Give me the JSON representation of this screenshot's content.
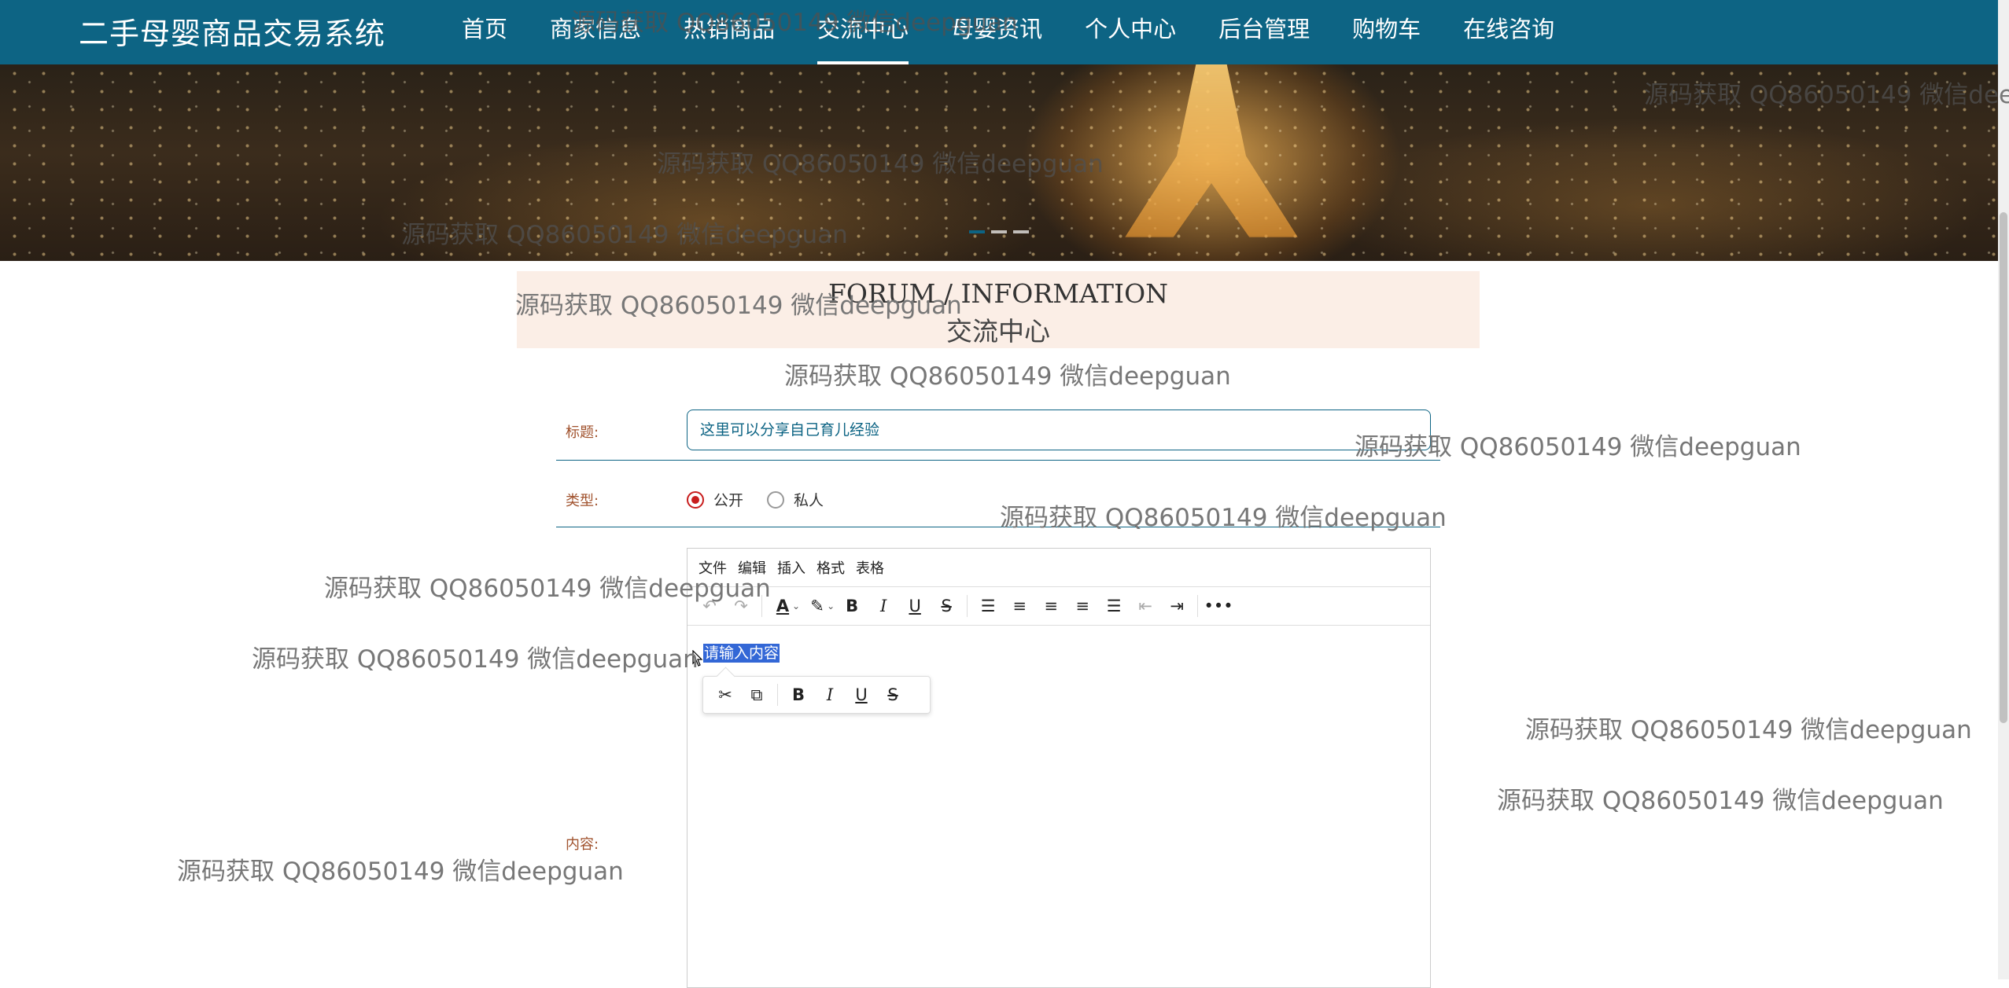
{
  "app": {
    "brand": "二手母婴商品交易系统"
  },
  "nav": {
    "items": [
      "首页",
      "商家信息",
      "热销商品",
      "交流中心",
      "母婴资讯",
      "个人中心",
      "后台管理",
      "购物车",
      "在线咨询"
    ],
    "active_index": 3
  },
  "banner": {
    "slides": 3,
    "active_slide": 1
  },
  "section": {
    "title_en": "FORUM / INFORMATION",
    "title_zh": "交流中心"
  },
  "form": {
    "title_label": "标题:",
    "title_value": "这里可以分享自己育儿经验",
    "type_label": "类型:",
    "type_options": [
      "公开",
      "私人"
    ],
    "type_selected": "公开",
    "content_label": "内容:"
  },
  "editor": {
    "menus": [
      "文件",
      "编辑",
      "插入",
      "格式",
      "表格"
    ],
    "placeholder": "请输入内容",
    "toolbar_icons": [
      "undo-icon",
      "redo-icon",
      "text-color-icon",
      "highlight-icon",
      "bold-icon",
      "italic-icon",
      "underline-icon",
      "strikethrough-icon",
      "line-height-icon",
      "align-left-icon",
      "align-center-icon",
      "align-right-icon",
      "align-justify-icon",
      "outdent-icon",
      "indent-icon",
      "more-icon"
    ],
    "quickbar_icons": [
      "cut-icon",
      "copy-icon",
      "bold-icon",
      "italic-icon",
      "underline-icon",
      "strikethrough-icon"
    ]
  },
  "watermark": "源码获取 QQ86050149 微信deepguan",
  "colors": {
    "nav_bg": "#0d6484",
    "heading_bg": "#fbeee6",
    "label": "#a0522d",
    "radio_checked": "#c81d1d",
    "selection": "#3367d6"
  }
}
